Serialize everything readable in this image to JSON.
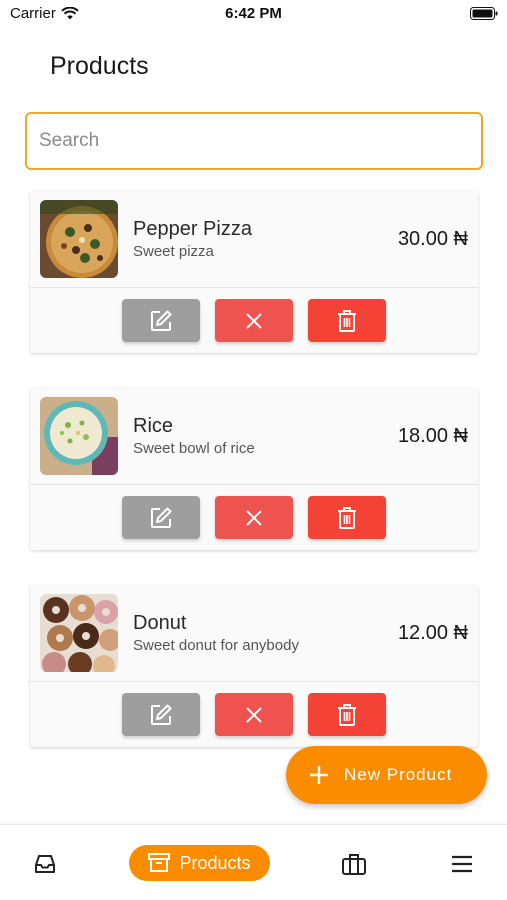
{
  "status": {
    "carrier": "Carrier",
    "time": "6:42 PM"
  },
  "page": {
    "title": "Products"
  },
  "search": {
    "placeholder": "Search",
    "value": ""
  },
  "products": [
    {
      "name": "Pepper Pizza",
      "description": "Sweet pizza",
      "price": "30.00 ₦",
      "image": "pizza-image"
    },
    {
      "name": "Rice",
      "description": "Sweet bowl of rice",
      "price": "18.00 ₦",
      "image": "rice-bowl-image"
    },
    {
      "name": "Donut",
      "description": "Sweet donut for anybody",
      "price": "12.00 ₦",
      "image": "donuts-image"
    }
  ],
  "actions": {
    "edit_icon": "edit-icon",
    "cancel_icon": "close-icon",
    "delete_icon": "trash-icon"
  },
  "fab": {
    "label": "New Product",
    "icon": "plus-icon"
  },
  "bottom_nav": {
    "items": [
      {
        "icon": "inbox-icon",
        "label": ""
      },
      {
        "icon": "archive-box-icon",
        "label": "Products",
        "active": true
      },
      {
        "icon": "briefcase-icon",
        "label": ""
      },
      {
        "icon": "menu-icon",
        "label": ""
      }
    ]
  },
  "colors": {
    "accent": "#fb8c00",
    "search_border": "#f5a623",
    "edit_button": "#9e9e9e",
    "cancel_button": "#ef5350",
    "delete_button": "#f44336"
  }
}
